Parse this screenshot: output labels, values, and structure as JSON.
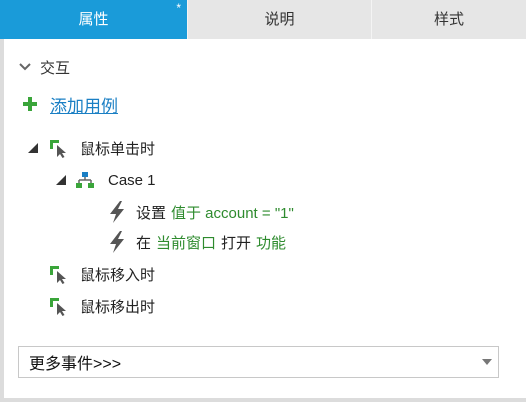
{
  "tabs": [
    {
      "label": "属性",
      "modified_marker": "*"
    },
    {
      "label": "说明"
    },
    {
      "label": "样式"
    }
  ],
  "interaction": {
    "section_label": "交互",
    "add_case_label": "添加用例",
    "events": [
      {
        "label": "鼠标单击时"
      },
      {
        "label": "鼠标移入时"
      },
      {
        "label": "鼠标移出时"
      }
    ],
    "case": {
      "label": "Case 1"
    },
    "actions": [
      {
        "verb": "设置",
        "detail": "值于 account = \"1\""
      },
      {
        "verb": "在",
        "target": "当前窗口",
        "verb2": "打开",
        "detail": "功能"
      }
    ],
    "more_events": "更多事件>>>"
  },
  "colors": {
    "accent": "#1a9bd9",
    "link": "#1a7fc4",
    "action_text": "#2e8b2e",
    "event_icon": "#3aa53a"
  },
  "icons": {
    "collapse": "chevron-down-icon",
    "add": "plus-icon",
    "event": "mouse-event-icon",
    "case": "case-icon",
    "action": "lightning-icon"
  }
}
